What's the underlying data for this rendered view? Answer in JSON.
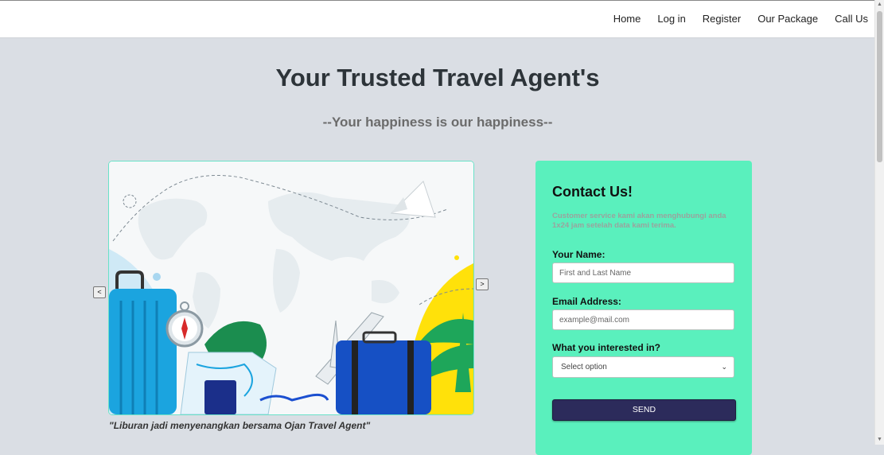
{
  "nav": {
    "links": [
      "Home",
      "Log in",
      "Register",
      "Our Package",
      "Call Us"
    ]
  },
  "hero": {
    "title": "Your Trusted Travel Agent's",
    "subtitle": "--Your happiness is our happiness--"
  },
  "carousel": {
    "prev_label": "<",
    "next_label": ">",
    "caption": "\"Liburan jadi menyenangkan bersama Ojan Travel Agent\""
  },
  "contact": {
    "title": "Contact Us!",
    "description": "Customer service kami akan menghubungi anda 1x24 jam setelah data kami terima.",
    "name_label": "Your Name:",
    "name_placeholder": "First and Last Name",
    "email_label": "Email Address:",
    "email_placeholder": "example@mail.com",
    "interest_label": "What you interested in?",
    "interest_selected": "Select option",
    "send_label": "SEND"
  },
  "colors": {
    "page_bg": "#dadee4",
    "contact_bg": "#5af0bd",
    "send_bg": "#2c2b5b",
    "carousel_border": "#69e2c8"
  },
  "icons": {
    "prev": "chevron-left-icon",
    "next": "chevron-right-icon",
    "select": "chevron-down-icon"
  }
}
